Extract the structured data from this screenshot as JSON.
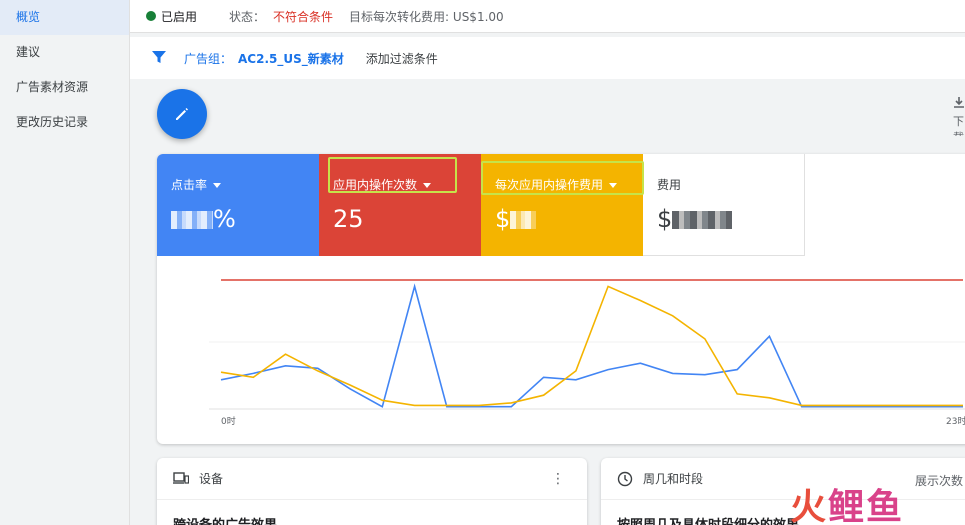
{
  "sidebar": {
    "items": [
      {
        "label": "概览",
        "active": true
      },
      {
        "label": "建议"
      },
      {
        "label": "广告素材资源"
      },
      {
        "label": "更改历史记录"
      }
    ]
  },
  "statusbar": {
    "enabled": "已启用",
    "status_label": "状态：",
    "status_value": "不符合条件",
    "target": "目标每次转化费用: US$1.00"
  },
  "filterbar": {
    "adgroup_label": "广告组：",
    "adgroup_value": "AC2.5_US_新素材",
    "add_filter": "添加过滤条件",
    "icon": "filter-icon"
  },
  "toolbar": {
    "download_label": "下载"
  },
  "metrics": [
    {
      "name": "点击率",
      "value": "%",
      "blurred": true,
      "color": "#4285f4"
    },
    {
      "name": "应用内操作次数",
      "value": "25",
      "color": "#db4437"
    },
    {
      "name": "每次应用内操作费用",
      "value": "$",
      "blurred": true,
      "color": "#f4b400"
    },
    {
      "name": "费用",
      "value": "$",
      "blurred": true
    }
  ],
  "chart_data": {
    "type": "line",
    "x_ticks": [
      "0时",
      "23时"
    ],
    "series": [
      {
        "color": "#4285f4",
        "values": [
          0.22,
          0.27,
          0.33,
          0.31,
          0.15,
          0.01,
          0.95,
          0.01,
          0.01,
          0.01,
          0.24,
          0.22,
          0.3,
          0.35,
          0.27,
          0.26,
          0.3,
          0.56,
          0.01,
          0.01,
          0.01,
          0.01,
          0.01,
          0.01
        ]
      },
      {
        "color": "#f4b400",
        "values": [
          0.28,
          0.24,
          0.42,
          0.29,
          0.18,
          0.06,
          0.02,
          0.02,
          0.02,
          0.04,
          0.1,
          0.29,
          0.95,
          0.84,
          0.72,
          0.54,
          0.11,
          0.08,
          0.02,
          0.02,
          0.02,
          0.02,
          0.02,
          0.02
        ]
      },
      {
        "color": "#db4437",
        "values": [
          1,
          1,
          1,
          1,
          1,
          1,
          1,
          1,
          1,
          1,
          1,
          1,
          1,
          1,
          1,
          1,
          1,
          1,
          1,
          1,
          1,
          1,
          1,
          1
        ]
      }
    ]
  },
  "cards": {
    "devices": {
      "title": "设备",
      "subtitle": "跨设备的广告效果",
      "icon": "devices-icon",
      "menu": "⋮"
    },
    "schedule": {
      "title": "周几和时段",
      "subtitle": "按照周几及具体时段细分的效果",
      "icon": "clock-icon",
      "right_label": "展示次数"
    }
  },
  "watermark": {
    "text1": "火",
    "text2": "鲤",
    "text3": "鱼"
  }
}
